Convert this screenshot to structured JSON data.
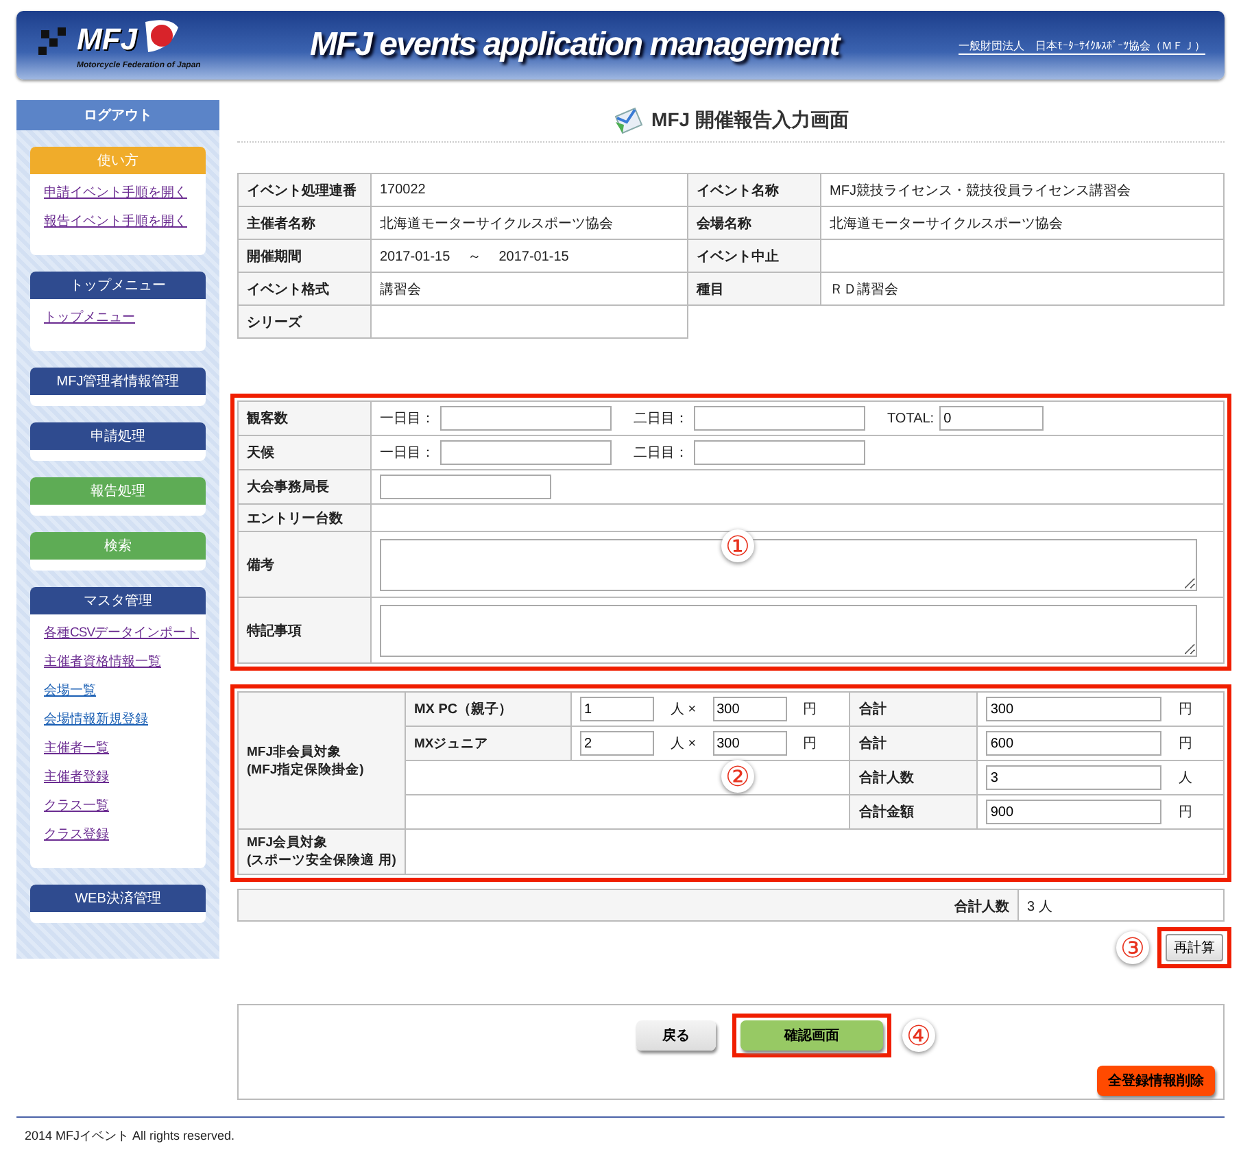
{
  "header": {
    "logo_text": "MFJ",
    "logo_caption": "Motorcycle Federation of Japan",
    "title": "MFJ events application management",
    "org": "一般財団法人　日本ﾓｰﾀｰｻｲｸﾙｽﾎﾟｰﾂ協会（ＭＦＪ）"
  },
  "sidebar": {
    "logout": "ログアウト",
    "sections": [
      {
        "title": "使い方",
        "color": "#f0ac2a",
        "links": [
          {
            "label": "申請イベント手順を開く",
            "visited": true
          },
          {
            "label": "報告イベント手順を開く",
            "visited": true
          }
        ]
      },
      {
        "title": "トップメニュー",
        "color": "#2f4b8f",
        "links": [
          {
            "label": "トップメニュー",
            "visited": true
          }
        ]
      },
      {
        "title": "MFJ管理者情報管理",
        "color": "#2f4b8f"
      },
      {
        "title": "申請処理",
        "color": "#2f4b8f"
      },
      {
        "title": "報告処理",
        "color": "#5eac55"
      },
      {
        "title": "検索",
        "color": "#5eac55"
      },
      {
        "title": "マスタ管理",
        "color": "#2f4b8f",
        "links": [
          {
            "label": "各種CSVデータインポート",
            "visited": true
          },
          {
            "label": "主催者資格情報一覧",
            "visited": true
          },
          {
            "label": "会場一覧",
            "visited": false
          },
          {
            "label": "会場情報新規登録",
            "visited": false
          },
          {
            "label": "主催者一覧",
            "visited": true
          },
          {
            "label": "主催者登録",
            "visited": true
          },
          {
            "label": "クラス一覧",
            "visited": true
          },
          {
            "label": "クラス登録",
            "visited": true
          }
        ]
      },
      {
        "title": "WEB決済管理",
        "color": "#2f4b8f"
      }
    ]
  },
  "page_title": "MFJ 開催報告入力画面",
  "event_info": [
    [
      {
        "label": "イベント処理連番",
        "value": "170022"
      },
      {
        "label": "イベント名称",
        "value": "MFJ競技ライセンス・競技役員ライセンス講習会"
      }
    ],
    [
      {
        "label": "主催者名称",
        "value": "北海道モーターサイクルスポーツ協会"
      },
      {
        "label": "会場名称",
        "value": "北海道モーターサイクルスポーツ協会"
      }
    ],
    [
      {
        "label": "開催期間",
        "value": "2017-01-15　 ～　 2017-01-15"
      },
      {
        "label": "イベント中止"
      }
    ],
    [
      {
        "label": "イベント格式",
        "value": "講習会"
      },
      {
        "label": "種目",
        "value": "ＲＤ講習会"
      }
    ],
    [
      {
        "label": "シリーズ"
      }
    ]
  ],
  "report": {
    "marker": "①",
    "rows": [
      {
        "kind": "fields",
        "label": "観客数",
        "fields": [
          {
            "label": "一日目："
          },
          {
            "label": "二日目："
          },
          {
            "label": "TOTAL:",
            "value": "0"
          }
        ]
      },
      {
        "kind": "fields",
        "label": "天候",
        "fields": [
          {
            "label": "一日目："
          },
          {
            "label": "二日目："
          }
        ]
      },
      {
        "kind": "input",
        "label": "大会事務局長"
      },
      {
        "kind": "text",
        "label": "エントリー台数"
      },
      {
        "kind": "textarea",
        "label": "備考"
      },
      {
        "kind": "textarea",
        "label": "特記事項"
      }
    ]
  },
  "fees": {
    "marker": "②",
    "nonmember_label": "MFJ非会員対象\n(MFJ指定保険掛金)",
    "lines": [
      {
        "class": "MX PC（親子）",
        "count": "1",
        "unit": "人 ×",
        "price": "300",
        "currency": "円",
        "sum_label": "合計",
        "sum": "300",
        "sum_unit": "円"
      },
      {
        "class": "MXジュニア",
        "count": "2",
        "unit": "人 ×",
        "price": "300",
        "currency": "円",
        "sum_label": "合計",
        "sum": "600",
        "sum_unit": "円"
      }
    ],
    "totals": [
      {
        "label": "合計人数",
        "value": "3",
        "unit": "人"
      },
      {
        "label": "合計金額",
        "value": "900",
        "unit": "円"
      }
    ],
    "member_label": "MFJ会員対象\n(スポーツ安全保険適 用)"
  },
  "summary": {
    "label": "合計人数",
    "value": "3 人"
  },
  "recalc": {
    "marker": "③",
    "label": "再計算"
  },
  "actions": {
    "back": "戻る",
    "confirm": "確認画面",
    "marker": "④",
    "delete": "全登録情報削除"
  },
  "footer": "2014 MFJイベント All rights reserved."
}
